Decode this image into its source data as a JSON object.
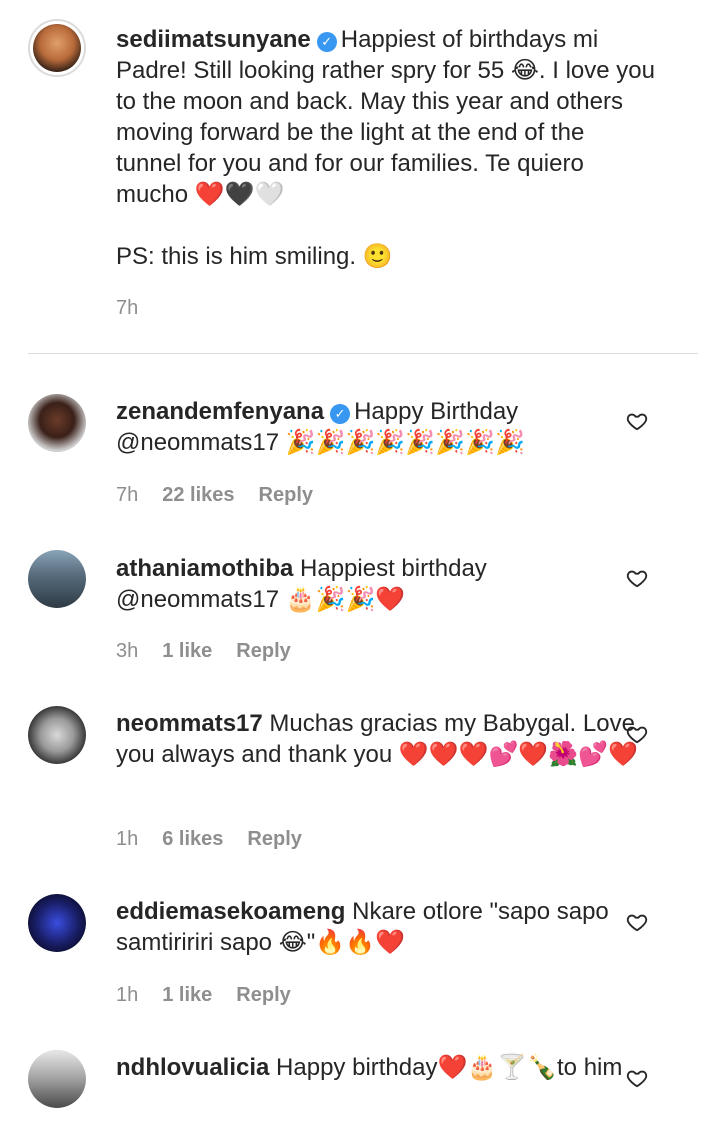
{
  "comments": [
    {
      "username": "sediimatsunyane",
      "verified": true,
      "text": "Happiest of birthdays mi Padre! Still looking rather spry for 55 😂. I love you to the moon and back. May this year and others moving forward be the light at the end of the tunnel for you and for our families. Te quiero mucho ❤️🖤🤍",
      "text2": "PS: this is him smiling. 🙂",
      "time": "7h"
    },
    {
      "username": "zenandemfenyana",
      "verified": true,
      "text": "Happy Birthday @neommats17 🎉🎉🎉🎉🎉🎉🎉🎉",
      "time": "7h",
      "likes": "22 likes",
      "reply": "Reply"
    },
    {
      "username": "athaniamothiba",
      "verified": false,
      "text": "Happiest birthday @neommats17 🎂🎉🎉❤️",
      "time": "3h",
      "likes": "1 like",
      "reply": "Reply"
    },
    {
      "username": "neommats17",
      "verified": false,
      "text": "Muchas gracias my Babygal. Love you always and thank you ❤️❤️❤️💕❤️🌺💕❤️",
      "time": "1h",
      "likes": "6 likes",
      "reply": "Reply"
    },
    {
      "username": "eddiemasekoameng",
      "verified": false,
      "text": "Nkare otlore \"sapo sapo samtiririri sapo 😂\"🔥🔥❤️",
      "time": "1h",
      "likes": "1 like",
      "reply": "Reply"
    },
    {
      "username": "ndhlovualicia",
      "verified": false,
      "text": "Happy birthday❤️🎂🍸🍾to him"
    }
  ],
  "colors": {
    "text": "#262626",
    "meta": "#8e8e8e",
    "verified": "#3897f0",
    "divider": "#dbdbdb"
  },
  "icons": {
    "like": "heart-outline-icon",
    "verified": "verified-badge-icon"
  }
}
